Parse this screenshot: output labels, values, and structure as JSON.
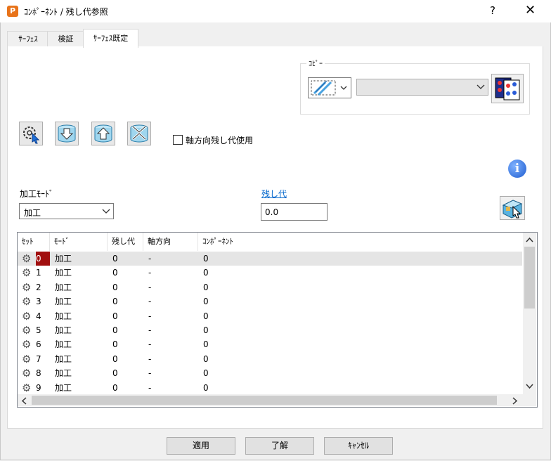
{
  "window": {
    "title": "ｺﾝﾎﾟｰﾈﾝﾄ / 残し代参照",
    "help_label": "?",
    "close_label": "✕",
    "app_icon_letter": "P"
  },
  "tabs": [
    {
      "label": "ｻｰﾌｪｽ",
      "active": false
    },
    {
      "label": "検証",
      "active": false
    },
    {
      "label": "ｻｰﾌｪｽ既定",
      "active": true
    }
  ],
  "copy_group": {
    "title": "ｺﾋﾟｰ",
    "source_value": ""
  },
  "axial_checkbox": {
    "label": "軸方向残し代使用",
    "checked": false
  },
  "machining_mode": {
    "label": "加工ﾓｰﾄﾞ",
    "value": "加工"
  },
  "allowance": {
    "label": "残し代",
    "value": "0.0"
  },
  "table": {
    "columns": [
      "ｾｯﾄ",
      "ﾓｰﾄﾞ",
      "残し代",
      "軸方向",
      "ｺﾝﾎﾟｰﾈﾝﾄ"
    ],
    "rows": [
      [
        "0",
        "加工",
        "0",
        "-",
        "0"
      ],
      [
        "1",
        "加工",
        "0",
        "-",
        "0"
      ],
      [
        "2",
        "加工",
        "0",
        "-",
        "0"
      ],
      [
        "3",
        "加工",
        "0",
        "-",
        "0"
      ],
      [
        "4",
        "加工",
        "0",
        "-",
        "0"
      ],
      [
        "5",
        "加工",
        "0",
        "-",
        "0"
      ],
      [
        "6",
        "加工",
        "0",
        "-",
        "0"
      ],
      [
        "7",
        "加工",
        "0",
        "-",
        "0"
      ],
      [
        "8",
        "加工",
        "0",
        "-",
        "0"
      ],
      [
        "9",
        "加工",
        "0",
        "-",
        "0"
      ]
    ],
    "selected_row": 0
  },
  "buttons": {
    "apply": "適用",
    "ok": "了解",
    "cancel": "ｷｬﾝｾﾙ"
  },
  "icons": {
    "tool_buttons": [
      "settings-select-icon",
      "arrow-down-icon",
      "arrow-up-icon",
      "collapse-icon"
    ],
    "copy_dropdown": "surface-copy-icon",
    "copy_button": "copy-preview-icon",
    "info": "info-icon",
    "apply_all": "apply-selection-icon",
    "row_gear": "gear-icon"
  },
  "colors": {
    "link": "#0066cc",
    "selected_cell": "#a10f0f",
    "app_icon": "#e8731a"
  }
}
